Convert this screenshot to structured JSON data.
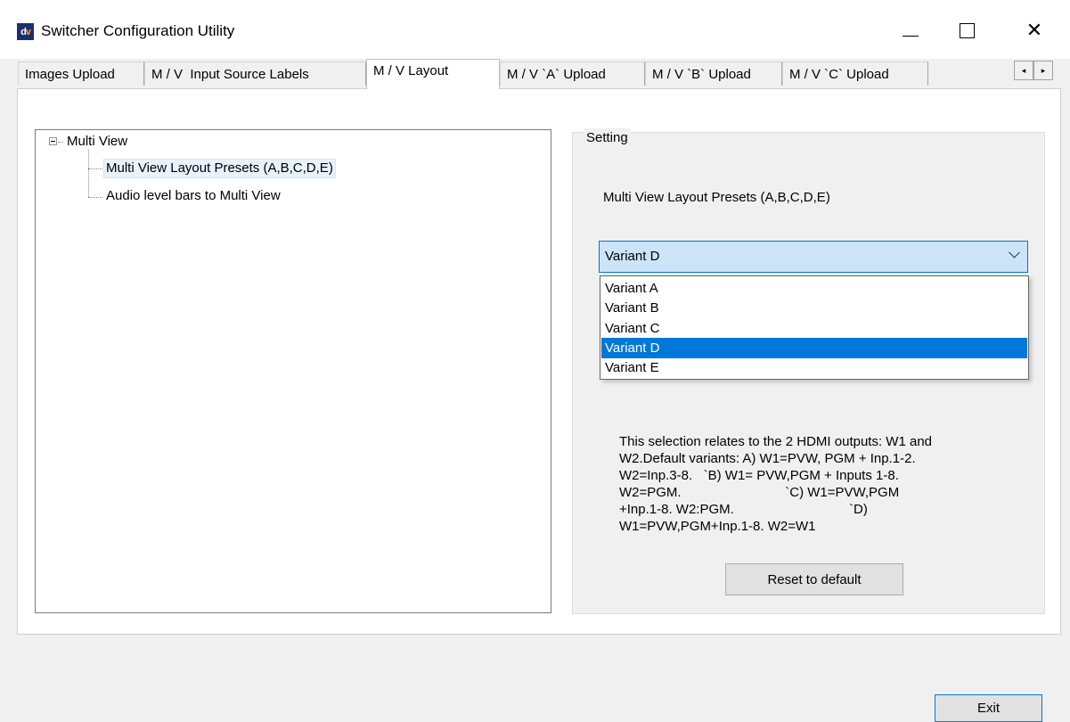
{
  "window": {
    "title": "Switcher Configuration Utility",
    "icon_text_d": "d",
    "icon_text_v": "v",
    "minimize_icon": "minimize-icon",
    "maximize_icon": "maximize-icon",
    "close_glyph": "✕"
  },
  "tabs": [
    {
      "label": "Images Upload"
    },
    {
      "label": "M / V  Input Source Labels"
    },
    {
      "label": "M / V Layout"
    },
    {
      "label": "M / V `A` Upload"
    },
    {
      "label": "M / V `B` Upload"
    },
    {
      "label": "M / V `C` Upload"
    }
  ],
  "active_tab_index": 2,
  "tab_scroll": {
    "left": "◂",
    "right": "▸"
  },
  "tree": {
    "root": "Multi View",
    "children": [
      "Multi View Layout Presets (A,B,C,D,E)",
      "Audio level bars to Multi View"
    ],
    "selected_index": 0
  },
  "setting": {
    "legend": "Setting",
    "label": "Multi View Layout Presets (A,B,C,D,E)",
    "combo_value": "Variant D",
    "options": [
      "Variant A",
      "Variant B",
      "Variant C",
      "Variant D",
      "Variant E"
    ],
    "highlighted_index": 3,
    "description": "This selection relates to the 2 HDMI outputs: W1 and\nW2.Default variants: A) W1=PVW, PGM + Inp.1-2.\nW2=Inp.3-8.   `B) W1= PVW,PGM + Inputs 1-8.\nW2=PGM.                            `C) W1=PVW,PGM\n+Inp.1-8. W2:PGM.                               `D)\nW1=PVW,PGM+Inp.1-8. W2=W1",
    "reset_label": "Reset to default"
  },
  "footer": {
    "exit_label": "Exit"
  },
  "colors": {
    "accent": "#0078d7",
    "combo_bg": "#cce4f7",
    "app_icon_bg": "#1e2f6e"
  }
}
